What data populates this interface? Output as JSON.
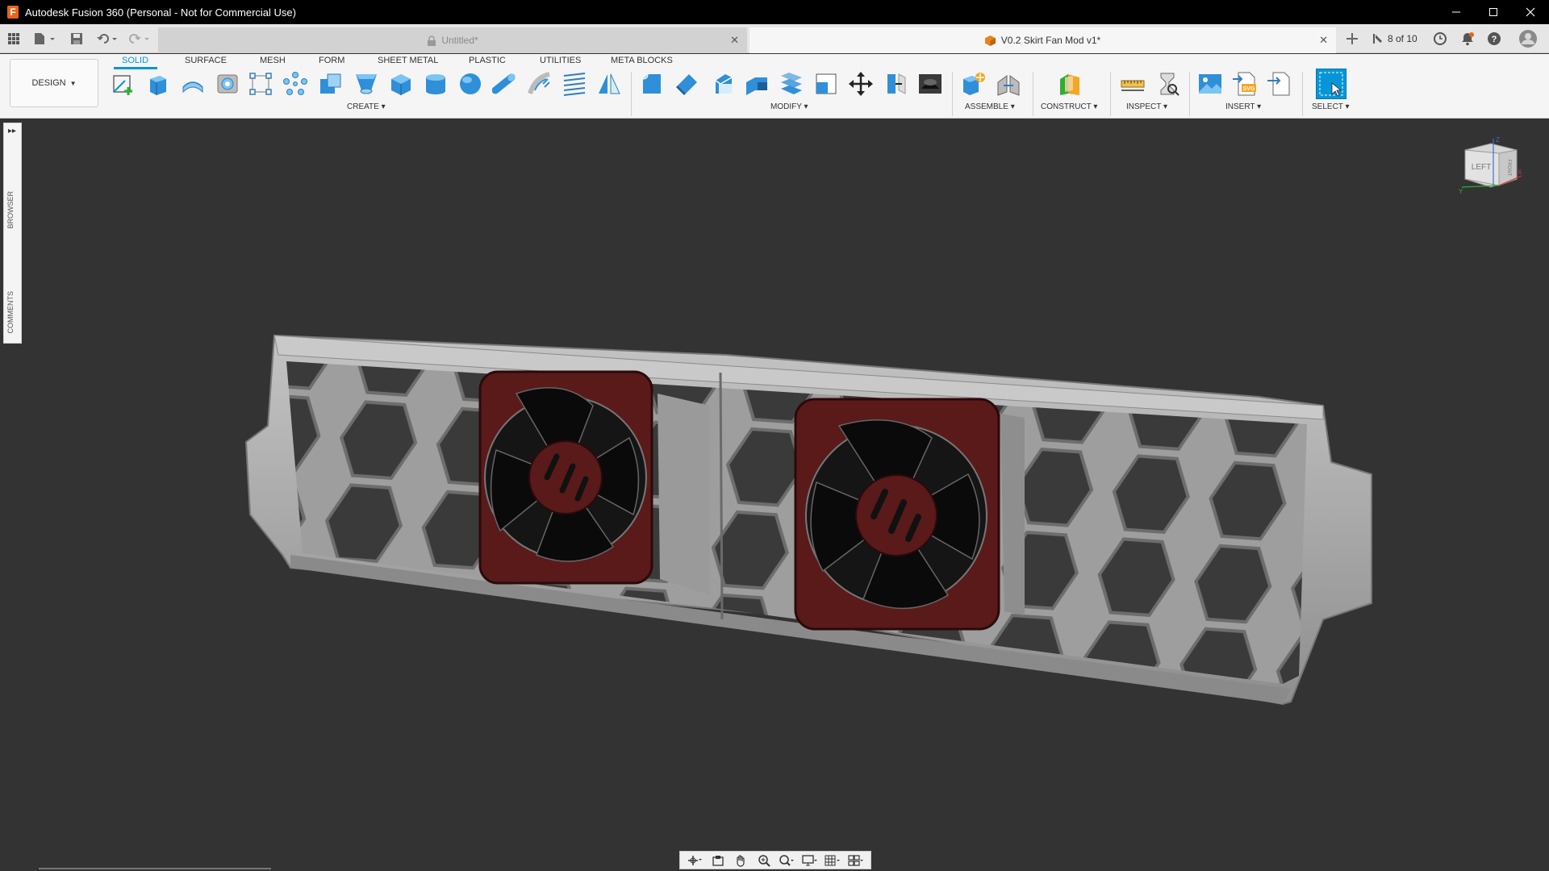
{
  "window": {
    "title": "Autodesk Fusion 360 (Personal - Not for Commercial Use)",
    "logo_letter": "F"
  },
  "tabs": [
    {
      "label": "Untitled*",
      "active": false
    },
    {
      "label": "V0.2 Skirt Fan Mod v1*",
      "active": true
    }
  ],
  "job_status": "8 of 10",
  "workspace": {
    "label": "DESIGN"
  },
  "ribbon_tabs": [
    "SOLID",
    "SURFACE",
    "MESH",
    "FORM",
    "SHEET METAL",
    "PLASTIC",
    "UTILITIES",
    "META BLOCKS"
  ],
  "groups": {
    "create": "CREATE",
    "modify": "MODIFY",
    "assemble": "ASSEMBLE",
    "construct": "CONSTRUCT",
    "inspect": "INSPECT",
    "insert": "INSERT",
    "select": "SELECT"
  },
  "side_panel": {
    "browser": "BROWSER",
    "comments": "COMMENTS"
  },
  "viewcube": {
    "face": "LEFT",
    "side": "FRONT",
    "axis_z": "Z",
    "axis_y": "Y",
    "axis_x": "X"
  },
  "icons": {
    "apps": "grid-icon",
    "file": "file-icon",
    "save": "save-icon",
    "undo": "undo-icon",
    "redo": "redo-icon",
    "new_tab": "plus-icon",
    "job": "job-status-icon",
    "clock": "clock-icon",
    "notifications": "bell-icon",
    "help": "help-icon",
    "profile": "avatar-icon"
  },
  "colors": {
    "accent": "#0696d7",
    "model_gray": "#a6a6a6",
    "fan_frame": "#5a1a1a",
    "viewport": "#333333"
  }
}
